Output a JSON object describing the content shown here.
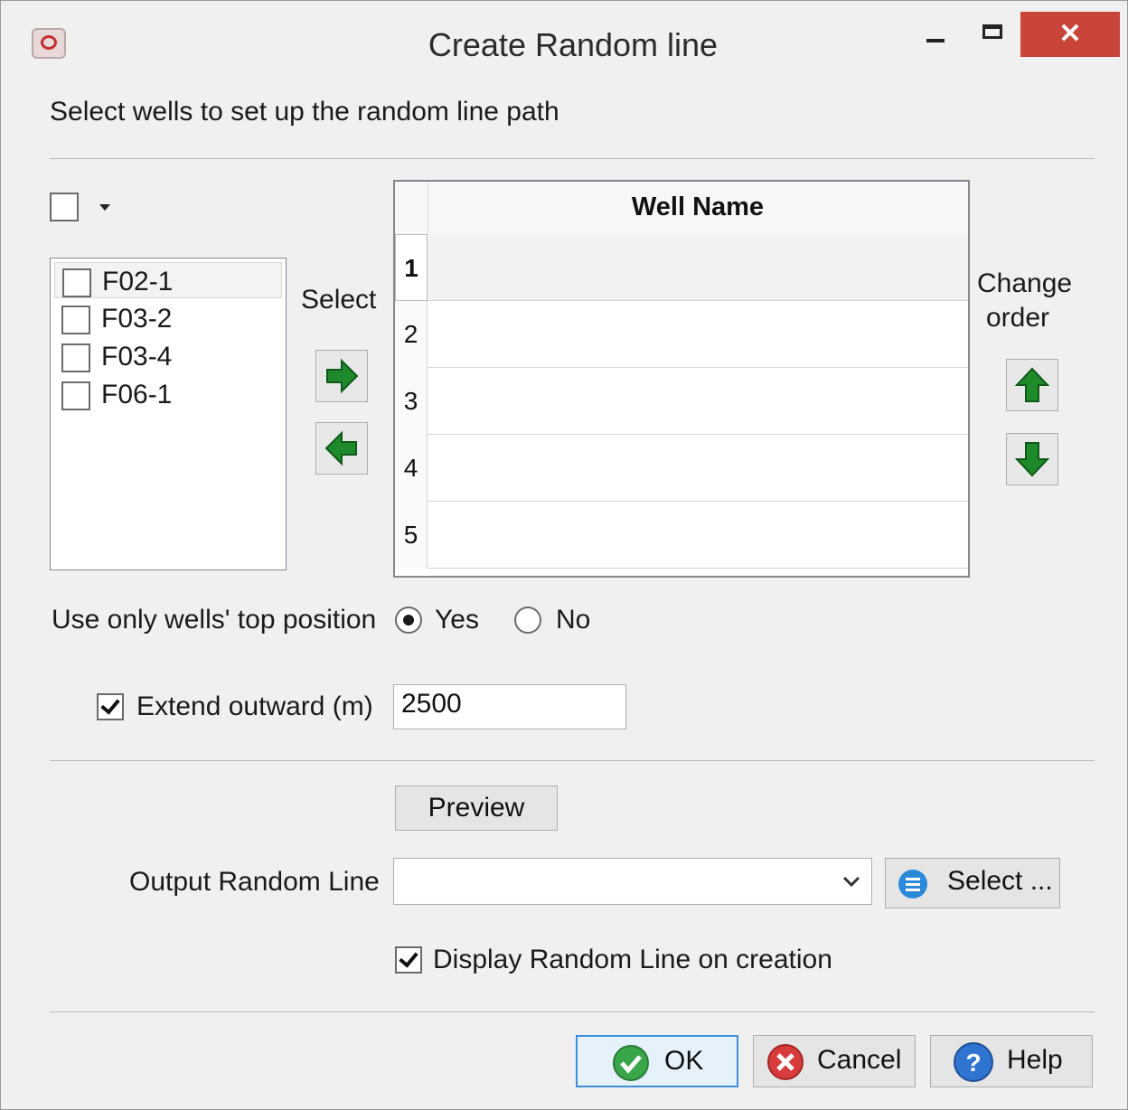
{
  "window": {
    "title": "Create Random line",
    "close_glyph": "✕"
  },
  "instruction": "Select wells to set up the random line path",
  "wells": [
    {
      "name": "F02-1",
      "checked": false
    },
    {
      "name": "F03-2",
      "checked": false
    },
    {
      "name": "F03-4",
      "checked": false
    },
    {
      "name": "F06-1",
      "checked": false
    }
  ],
  "select_label": "Select",
  "change_order_label_1": "Change",
  "change_order_label_2": "order",
  "grid": {
    "column_header": "Well Name",
    "rows": [
      "1",
      "2",
      "3",
      "4",
      "5"
    ]
  },
  "top_position": {
    "label": "Use only wells' top position",
    "yes_label": "Yes",
    "no_label": "No",
    "selected": "Yes"
  },
  "extend": {
    "label": "Extend outward (m)",
    "checked": true,
    "value": "2500"
  },
  "preview_label": "Preview",
  "output": {
    "label": "Output Random Line",
    "value": "",
    "select_button_label": "Select ..."
  },
  "display_on_creation": {
    "label": "Display Random Line on creation",
    "checked": true
  },
  "buttons": {
    "ok": "OK",
    "cancel": "Cancel",
    "help": "Help"
  },
  "colors": {
    "arrow_green": "#1e8a2c",
    "close_red": "#c9443a",
    "ok_green": "#3aa64a",
    "cancel_red": "#d83b3b",
    "help_blue": "#2f74d0",
    "select_blue": "#2a8ad8"
  },
  "icons": {
    "app": "app-icon",
    "select_right": "arrow-right-icon",
    "select_left": "arrow-left-icon",
    "move_up": "arrow-up-icon",
    "move_down": "arrow-down-icon",
    "select_list": "list-icon",
    "ok": "check-icon",
    "cancel": "cancel-x-icon",
    "help": "question-icon"
  }
}
